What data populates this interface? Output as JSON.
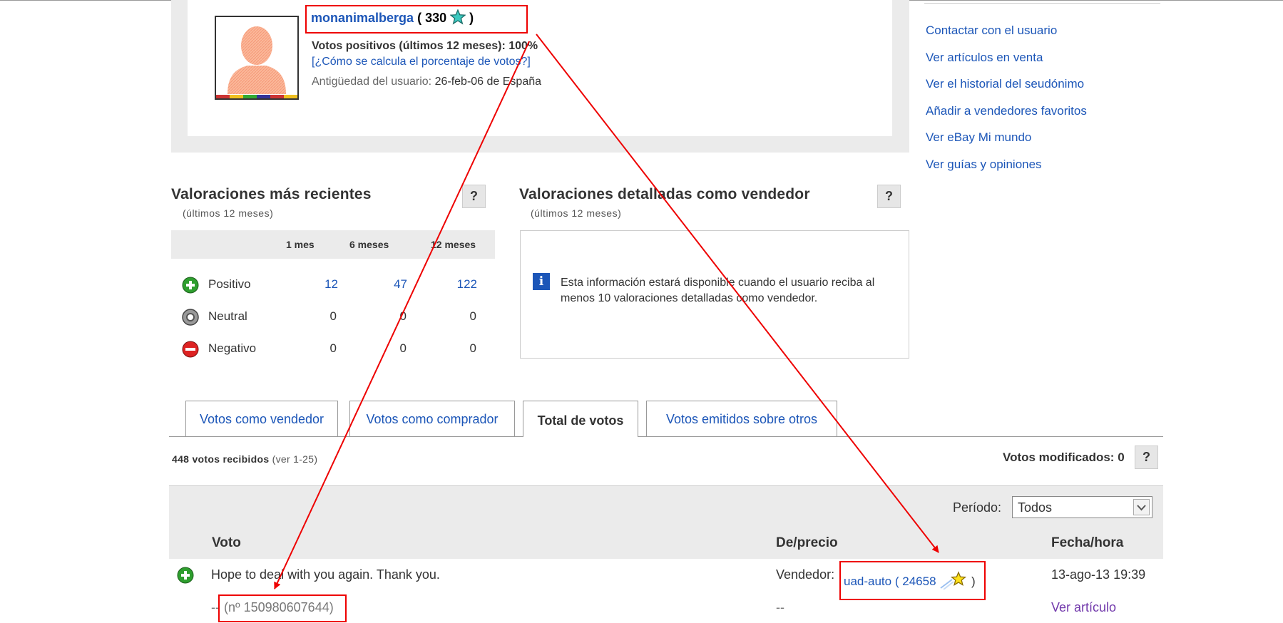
{
  "profile": {
    "username": "monanimalberga",
    "score_open": "(",
    "score": "330",
    "score_close": ")",
    "positive_label": "Votos positivos (últimos 12 meses):",
    "positive_value": "100%",
    "how_link": "[¿Cómo se calcula el porcentaje de votos?]",
    "since_label": "Antigüedad del usuario:",
    "since_value": "26-feb-06 de España"
  },
  "right_links": [
    "Contactar con el usuario",
    "Ver artículos en venta",
    "Ver el historial del seudónimo",
    "Añadir a vendedores favoritos",
    "Ver eBay Mi mundo",
    "Ver guías y opiniones"
  ],
  "recent": {
    "title": "Valoraciones más recientes",
    "subtitle": "(últimos 12 meses)",
    "help": "?",
    "columns": [
      "1 mes",
      "6 meses",
      "12 meses"
    ],
    "rows": [
      {
        "label": "Positivo",
        "values": [
          "12",
          "47",
          "122"
        ],
        "color": "#2e9e2e"
      },
      {
        "label": "Neutral",
        "values": [
          "0",
          "0",
          "0"
        ],
        "color": "#888888"
      },
      {
        "label": "Negativo",
        "values": [
          "0",
          "0",
          "0"
        ],
        "color": "#dd2222"
      }
    ]
  },
  "detailed": {
    "title": "Valoraciones detalladas como vendedor",
    "subtitle": "(últimos 12 meses)",
    "help": "?",
    "info_icon": "i",
    "info": "Esta información estará disponible cuando el usuario reciba al menos 10 valoraciones detalladas como vendedor."
  },
  "tabs": [
    {
      "label": "Votos como vendedor",
      "active": false
    },
    {
      "label": "Votos como comprador",
      "active": false
    },
    {
      "label": "Total de votos",
      "active": true
    },
    {
      "label": "Votos emitidos sobre otros",
      "active": false
    }
  ],
  "votes_received": {
    "bold": "448 votos recibidos",
    "rest": "(ver 1-25)"
  },
  "votes_modified": "Votos modificados: 0",
  "votes_modified_help": "?",
  "period": {
    "label": "Período:",
    "value": "Todos"
  },
  "table_headers": {
    "vote": "Voto",
    "from": "De/precio",
    "date": "Fecha/hora"
  },
  "feedback": {
    "comment": "Hope to deal with you again. Thank you.",
    "item_dash": "--",
    "item_number": "(nº 150980607644)",
    "from_label": "Vendedor:",
    "seller": "uad-auto",
    "seller_score_open": "(",
    "seller_score": "24658",
    "seller_score_close": ")",
    "price": "--",
    "date": "13-ago-13 19:39",
    "item_link": "Ver artículo"
  },
  "colors": {
    "link": "#1c56b8",
    "annotation": "#ee0000",
    "visited": "#7138ab"
  }
}
